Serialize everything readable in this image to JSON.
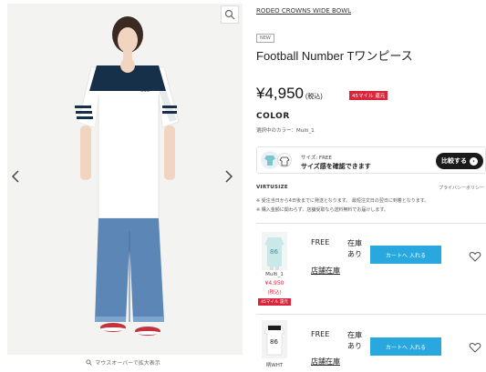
{
  "gallery": {
    "zoom_caption": "マウスオーバーで拡大表示"
  },
  "product": {
    "brand": "RODEO CROWNS WIDE BOWL",
    "new_badge": "NEW",
    "title": "Football Number Tワンピース",
    "price": "¥4,950",
    "tax": "(税込)",
    "miles": "45マイル 還元",
    "color_label": "COLOR",
    "selected_color": "選択中のカラー：Multi_1"
  },
  "virtusize": {
    "size_text": "サイズ: FREE",
    "cta": "サイズ感を確認できます",
    "compare_label": "比較する",
    "logo": "VIRTUSIZE",
    "privacy": "プライバシーポリシー"
  },
  "notes": [
    "※ 受注当日から4日後までに発送となります。 最短注文日の翌日に到着となります。",
    "※ 購入金額に関わらず、店舗受取なら送料無料でお届けします。"
  ],
  "variants": [
    {
      "name": "Multi_1",
      "price": "¥4,950",
      "tax": "(税込)",
      "miles": "45マイル 還元",
      "size": "FREE",
      "stock": "在庫\nあり",
      "store_link": "店舗在庫",
      "cart_label": "カートへ 入れる"
    },
    {
      "name": "柄WHT",
      "size": "FREE",
      "stock": "在庫\nあり",
      "store_link": "店舗在庫",
      "cart_label": "カートへ 入れる"
    }
  ],
  "colors": {
    "accent_red": "#d9263c",
    "cart_blue": "#29a7df",
    "dark_button": "#1b1b1b"
  }
}
